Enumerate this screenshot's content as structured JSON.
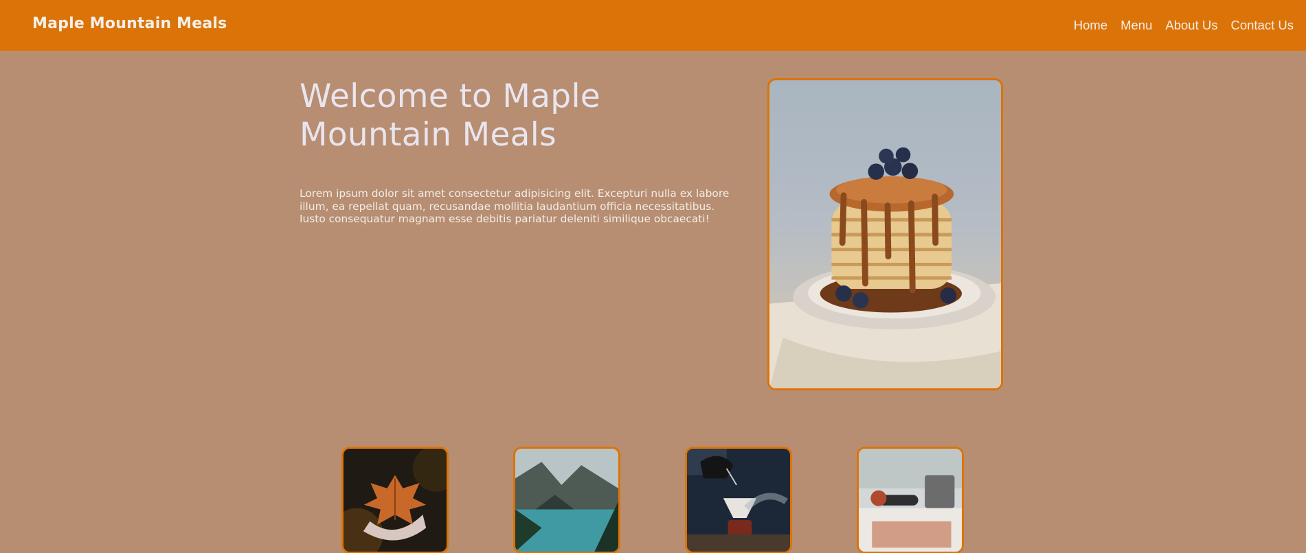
{
  "header": {
    "brand": "Maple Mountain Meals",
    "nav": [
      "Home",
      "Menu",
      "About Us",
      "Contact Us"
    ]
  },
  "hero": {
    "title": "Welcome to Maple Mountain Meals",
    "text": "Lorem ipsum dolor sit amet consectetur adipisicing elit. Excepturi nulla ex labore illum, ea repellat quam, recusandae mollitia laudantium officia necessitatibus. Iusto consequatur magnam esse debitis pariatur deleniti similique obcaecati!",
    "image": "pancake-stack-photo"
  },
  "thumbnails": [
    {
      "image": "maple-leaf-in-hands-photo"
    },
    {
      "image": "mountain-lake-photo"
    },
    {
      "image": "outdoor-coffee-pour-photo"
    },
    {
      "image": "kitchen-cooking-photo"
    }
  ],
  "colors": {
    "background": "#b78e72",
    "accent": "#dc7308",
    "text": "#eae4ef"
  }
}
